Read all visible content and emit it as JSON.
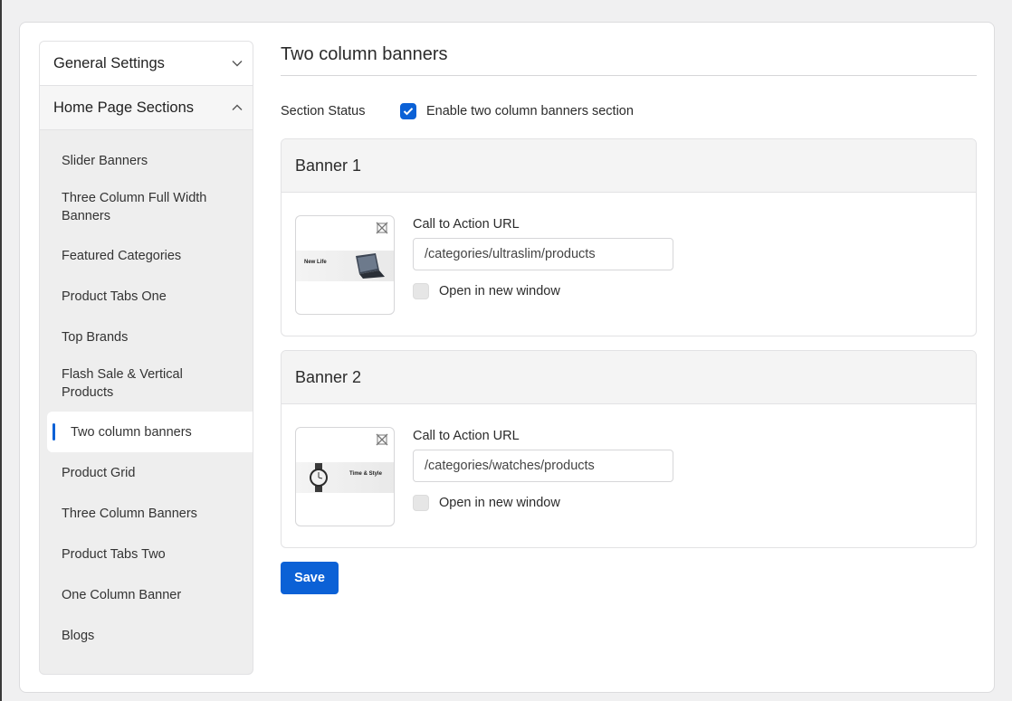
{
  "sidebar": {
    "general_settings": "General Settings",
    "home_page_sections": "Home Page Sections",
    "items": [
      {
        "label": "Slider Banners"
      },
      {
        "label": "Three Column Full Width Banners"
      },
      {
        "label": "Featured Categories"
      },
      {
        "label": "Product Tabs One"
      },
      {
        "label": "Top Brands"
      },
      {
        "label": "Flash Sale & Vertical Products"
      },
      {
        "label": "Two column banners"
      },
      {
        "label": "Product Grid"
      },
      {
        "label": "Three Column Banners"
      },
      {
        "label": "Product Tabs Two"
      },
      {
        "label": "One Column Banner"
      },
      {
        "label": "Blogs"
      }
    ]
  },
  "main": {
    "title": "Two column banners",
    "status_label": "Section Status",
    "status_checkbox_label": "Enable two column banners section",
    "status_enabled": true,
    "banners": [
      {
        "title": "Banner 1",
        "image_text": "New Life",
        "url_label": "Call to Action URL",
        "url_value": "/categories/ultraslim/products",
        "open_new_window_label": "Open in new window",
        "open_new_window": false
      },
      {
        "title": "Banner 2",
        "image_text": "Time & Style",
        "url_label": "Call to Action URL",
        "url_value": "/categories/watches/products",
        "open_new_window_label": "Open in new window",
        "open_new_window": false
      }
    ],
    "save_label": "Save"
  },
  "colors": {
    "accent": "#0b61d6",
    "sidebar_bg": "#eeeeee",
    "page_bg": "#f0f0f1"
  }
}
